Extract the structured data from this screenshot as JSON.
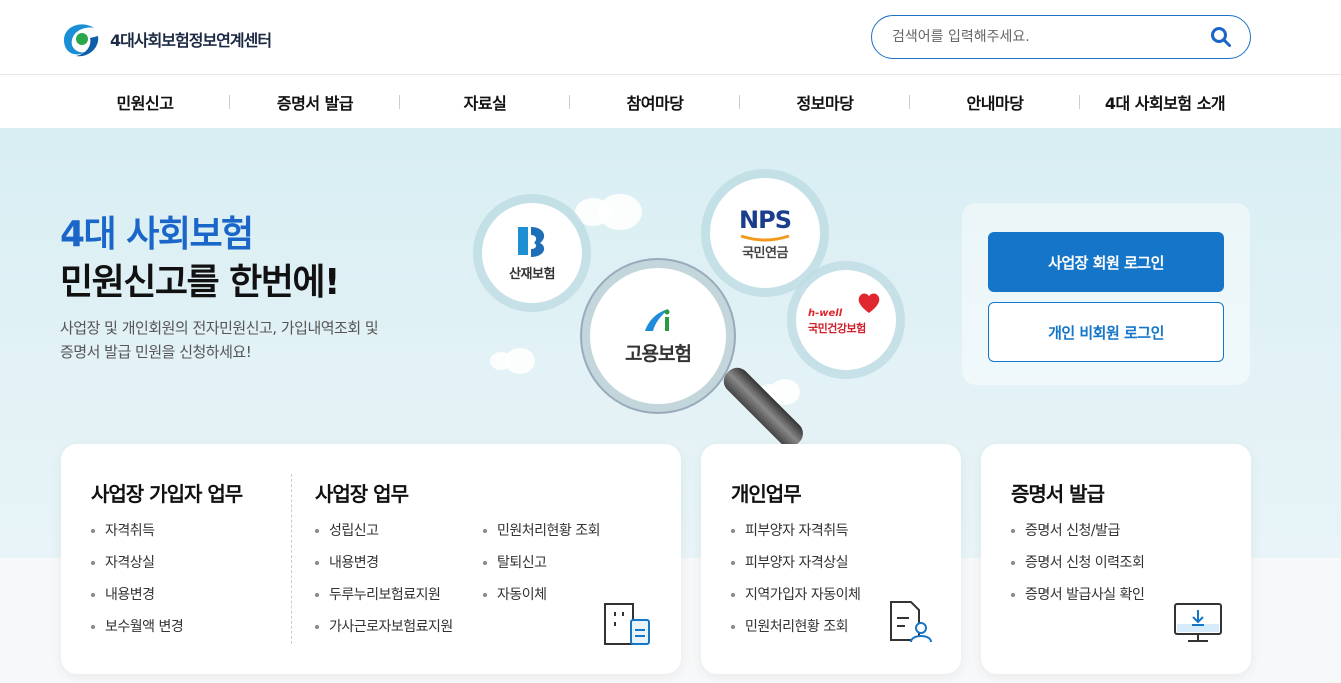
{
  "header": {
    "logo_text": "4대사회보험정보연계센터",
    "search_placeholder": "검색어를 입력해주세요."
  },
  "nav": {
    "items": [
      "민원신고",
      "증명서 발급",
      "자료실",
      "참여마당",
      "정보마당",
      "안내마당",
      "4대 사회보험 소개"
    ]
  },
  "hero": {
    "title_line1": "4대 사회보험",
    "title_line2": "민원신고를 한번에!",
    "description_line1": "사업장 및 개인회원의 전자민원신고, 가입내역조회 및",
    "description_line2": "증명서 발급 민원을 신청하세요!",
    "insurers": {
      "sanjae": "산재보험",
      "nps_logo": "NPS",
      "nps": "국민연금",
      "goyong": "고용보험",
      "hwell": "h-well",
      "health": "국민건강보험"
    }
  },
  "login": {
    "business_button": "사업장 회원 로그인",
    "personal_button": "개인 비회원 로그인"
  },
  "cards": {
    "subscriber": {
      "title": "사업장 가입자 업무",
      "items": [
        "자격취득",
        "자격상실",
        "내용변경",
        "보수월액 변경"
      ]
    },
    "workplace": {
      "title": "사업장 업무",
      "items_left": [
        "성립신고",
        "내용변경",
        "두루누리보험료지원",
        "가사근로자보험료지원"
      ],
      "items_right": [
        "민원처리현황 조회",
        "탈퇴신고",
        "자동이체"
      ]
    },
    "personal": {
      "title": "개인업무",
      "items": [
        "피부양자 자격취득",
        "피부양자 자격상실",
        "지역가입자 자동이체",
        "민원처리현황 조회"
      ]
    },
    "certificate": {
      "title": "증명서 발급",
      "items": [
        "증명서 신청/발급",
        "증명서 신청 이력조회",
        "증명서 발급사실 확인"
      ]
    }
  },
  "colors": {
    "brand_blue": "#1576c9",
    "title_blue": "#1b66c9",
    "hero_bg": "#d8eef3"
  }
}
